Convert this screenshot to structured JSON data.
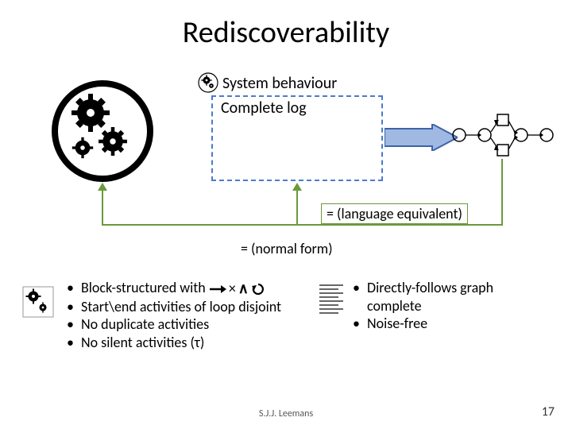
{
  "title": "Rediscoverability",
  "system_behaviour_label": "System behaviour",
  "complete_log_label": "Complete log",
  "lang_equiv_label": "= (language equivalent)",
  "normal_form_label": "= (normal form)",
  "left_bullets": [
    "Block-structured with",
    "Start\\end activities of loop disjoint",
    "No duplicate activities",
    "No silent activities (τ)"
  ],
  "operators": {
    "times": "×",
    "and": "∧"
  },
  "right_bullets": [
    "Directly-follows graph complete",
    "Noise-free"
  ],
  "footer": {
    "author": "S.J.J. Leemans",
    "page": "17"
  },
  "colors": {
    "green": "#6A9A3C",
    "blue": "#4A7BD0",
    "arrow_fill": "#9FB9E3"
  }
}
